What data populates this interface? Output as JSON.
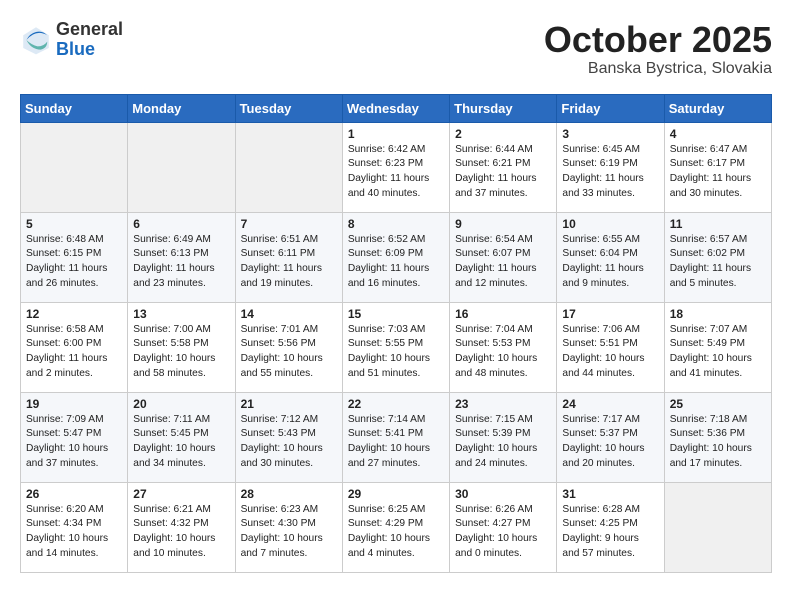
{
  "header": {
    "logo_general": "General",
    "logo_blue": "Blue",
    "month": "October 2025",
    "location": "Banska Bystrica, Slovakia"
  },
  "weekdays": [
    "Sunday",
    "Monday",
    "Tuesday",
    "Wednesday",
    "Thursday",
    "Friday",
    "Saturday"
  ],
  "rows": [
    [
      {
        "day": "",
        "text": ""
      },
      {
        "day": "",
        "text": ""
      },
      {
        "day": "",
        "text": ""
      },
      {
        "day": "1",
        "text": "Sunrise: 6:42 AM\nSunset: 6:23 PM\nDaylight: 11 hours\nand 40 minutes."
      },
      {
        "day": "2",
        "text": "Sunrise: 6:44 AM\nSunset: 6:21 PM\nDaylight: 11 hours\nand 37 minutes."
      },
      {
        "day": "3",
        "text": "Sunrise: 6:45 AM\nSunset: 6:19 PM\nDaylight: 11 hours\nand 33 minutes."
      },
      {
        "day": "4",
        "text": "Sunrise: 6:47 AM\nSunset: 6:17 PM\nDaylight: 11 hours\nand 30 minutes."
      }
    ],
    [
      {
        "day": "5",
        "text": "Sunrise: 6:48 AM\nSunset: 6:15 PM\nDaylight: 11 hours\nand 26 minutes."
      },
      {
        "day": "6",
        "text": "Sunrise: 6:49 AM\nSunset: 6:13 PM\nDaylight: 11 hours\nand 23 minutes."
      },
      {
        "day": "7",
        "text": "Sunrise: 6:51 AM\nSunset: 6:11 PM\nDaylight: 11 hours\nand 19 minutes."
      },
      {
        "day": "8",
        "text": "Sunrise: 6:52 AM\nSunset: 6:09 PM\nDaylight: 11 hours\nand 16 minutes."
      },
      {
        "day": "9",
        "text": "Sunrise: 6:54 AM\nSunset: 6:07 PM\nDaylight: 11 hours\nand 12 minutes."
      },
      {
        "day": "10",
        "text": "Sunrise: 6:55 AM\nSunset: 6:04 PM\nDaylight: 11 hours\nand 9 minutes."
      },
      {
        "day": "11",
        "text": "Sunrise: 6:57 AM\nSunset: 6:02 PM\nDaylight: 11 hours\nand 5 minutes."
      }
    ],
    [
      {
        "day": "12",
        "text": "Sunrise: 6:58 AM\nSunset: 6:00 PM\nDaylight: 11 hours\nand 2 minutes."
      },
      {
        "day": "13",
        "text": "Sunrise: 7:00 AM\nSunset: 5:58 PM\nDaylight: 10 hours\nand 58 minutes."
      },
      {
        "day": "14",
        "text": "Sunrise: 7:01 AM\nSunset: 5:56 PM\nDaylight: 10 hours\nand 55 minutes."
      },
      {
        "day": "15",
        "text": "Sunrise: 7:03 AM\nSunset: 5:55 PM\nDaylight: 10 hours\nand 51 minutes."
      },
      {
        "day": "16",
        "text": "Sunrise: 7:04 AM\nSunset: 5:53 PM\nDaylight: 10 hours\nand 48 minutes."
      },
      {
        "day": "17",
        "text": "Sunrise: 7:06 AM\nSunset: 5:51 PM\nDaylight: 10 hours\nand 44 minutes."
      },
      {
        "day": "18",
        "text": "Sunrise: 7:07 AM\nSunset: 5:49 PM\nDaylight: 10 hours\nand 41 minutes."
      }
    ],
    [
      {
        "day": "19",
        "text": "Sunrise: 7:09 AM\nSunset: 5:47 PM\nDaylight: 10 hours\nand 37 minutes."
      },
      {
        "day": "20",
        "text": "Sunrise: 7:11 AM\nSunset: 5:45 PM\nDaylight: 10 hours\nand 34 minutes."
      },
      {
        "day": "21",
        "text": "Sunrise: 7:12 AM\nSunset: 5:43 PM\nDaylight: 10 hours\nand 30 minutes."
      },
      {
        "day": "22",
        "text": "Sunrise: 7:14 AM\nSunset: 5:41 PM\nDaylight: 10 hours\nand 27 minutes."
      },
      {
        "day": "23",
        "text": "Sunrise: 7:15 AM\nSunset: 5:39 PM\nDaylight: 10 hours\nand 24 minutes."
      },
      {
        "day": "24",
        "text": "Sunrise: 7:17 AM\nSunset: 5:37 PM\nDaylight: 10 hours\nand 20 minutes."
      },
      {
        "day": "25",
        "text": "Sunrise: 7:18 AM\nSunset: 5:36 PM\nDaylight: 10 hours\nand 17 minutes."
      }
    ],
    [
      {
        "day": "26",
        "text": "Sunrise: 6:20 AM\nSunset: 4:34 PM\nDaylight: 10 hours\nand 14 minutes."
      },
      {
        "day": "27",
        "text": "Sunrise: 6:21 AM\nSunset: 4:32 PM\nDaylight: 10 hours\nand 10 minutes."
      },
      {
        "day": "28",
        "text": "Sunrise: 6:23 AM\nSunset: 4:30 PM\nDaylight: 10 hours\nand 7 minutes."
      },
      {
        "day": "29",
        "text": "Sunrise: 6:25 AM\nSunset: 4:29 PM\nDaylight: 10 hours\nand 4 minutes."
      },
      {
        "day": "30",
        "text": "Sunrise: 6:26 AM\nSunset: 4:27 PM\nDaylight: 10 hours\nand 0 minutes."
      },
      {
        "day": "31",
        "text": "Sunrise: 6:28 AM\nSunset: 4:25 PM\nDaylight: 9 hours\nand 57 minutes."
      },
      {
        "day": "",
        "text": ""
      }
    ]
  ]
}
